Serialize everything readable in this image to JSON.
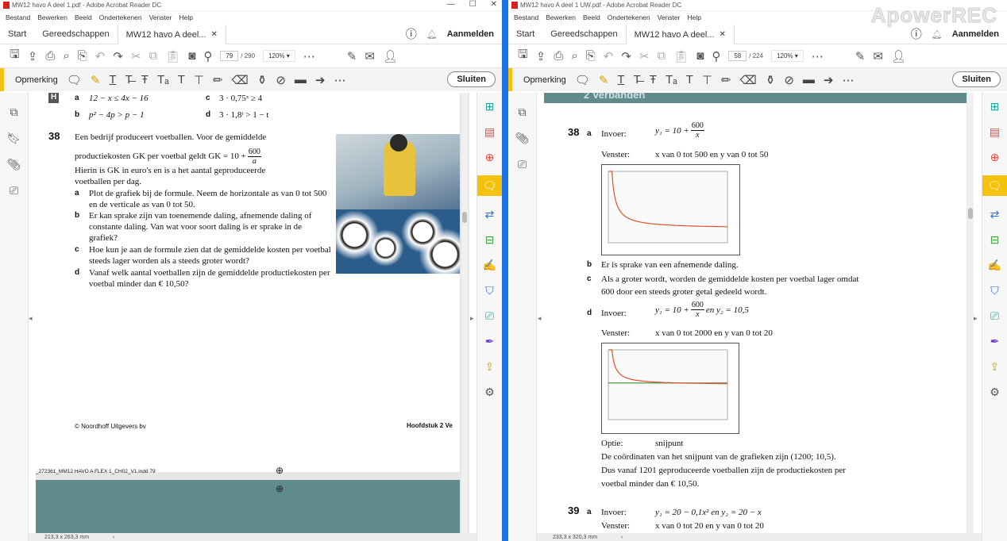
{
  "left": {
    "title": "MW12 havo A deel 1.pdf - Adobe Acrobat Reader DC",
    "menu": [
      "Bestand",
      "Bewerken",
      "Beeld",
      "Ondertekenen",
      "Venster",
      "Help"
    ],
    "tabs": {
      "start": "Start",
      "tools": "Gereedschappen",
      "doc": "MW12 havo A deel..."
    },
    "signin": "Aanmelden",
    "page_current": "79",
    "page_total": "/ 290",
    "zoom": "120%",
    "comment_label": "Opmerking",
    "close_label": "Sluiten",
    "page_size": "213,3 x 263,3 mm",
    "content": {
      "h_label": "H",
      "h_a_label": "a",
      "h_a": "12 − x ≤ 4x − 16",
      "h_c_label": "c",
      "h_c": "3 · 0,75ˣ ≥ 4",
      "h_b_label": "b",
      "h_b": "p² − 4p > p − 1",
      "h_d_label": "d",
      "h_d": "3 · 1,8ᵗ > 1 − t",
      "q38_num": "38",
      "q38_line1": "Een bedrijf produceert voetballen. Voor de gemiddelde",
      "q38_line2a": "productiekosten GK per voetbal geldt GK = 10 +",
      "q38_frac_n": "600",
      "q38_frac_d": "a",
      "q38_line3": "Hierin is GK in euro's en is a het aantal geproduceerde",
      "q38_line4": "voetballen per dag.",
      "q38_a_label": "a",
      "q38_a": "Plot de grafiek bij de formule. Neem de horizontale as van 0 tot 500 en de verticale as van 0 tot 50.",
      "q38_b_label": "b",
      "q38_b": "Er kan sprake zijn van toenemende daling, afnemende daling of constante daling. Van wat voor soort daling is er sprake in de grafiek?",
      "q38_c_label": "c",
      "q38_c": "Hoe kun je aan de formule zien dat de gemiddelde kosten per voetbal steeds lager worden als a steeds groter wordt?",
      "q38_d_label": "d",
      "q38_d": "Vanaf welk aantal voetballen zijn de gemiddelde productiekosten per voetbal minder dan € 10,50?",
      "footer_left": "© Noordhoff Uitgevers bv",
      "footer_right": "Hoofdstuk 2 Ve",
      "print_line": "_272361_MM12 HAVO A FLEX 1_CH02_V1.indd   79"
    }
  },
  "right": {
    "title": "MW12 havo A deel 1 UW.pdf - Adobe Acrobat Reader DC",
    "menu": [
      "Bestand",
      "Bewerken",
      "Beeld",
      "Ondertekenen",
      "Venster",
      "Help"
    ],
    "tabs": {
      "start": "Start",
      "tools": "Gereedschappen",
      "doc": "MW12 havo A deel..."
    },
    "signin": "Aanmelden",
    "page_current": "58",
    "page_total": "/ 224",
    "zoom": "120%",
    "comment_label": "Opmerking",
    "close_label": "Sluiten",
    "page_size": "233,3 x 320,3 mm",
    "watermark": "ApowerREC",
    "content": {
      "banner": "2 Verbanden",
      "q38_num": "38",
      "q38_a_label": "a",
      "invoer": "Invoer:",
      "venster": "Venster:",
      "y1_a": "y₁ = 10 +",
      "frac_n": "600",
      "frac_d": "x",
      "venster_a": "x van 0 tot 500 en y van 0 tot 50",
      "b_label": "b",
      "b_text": "Er is sprake van een afnemende daling.",
      "c_label": "c",
      "c_text1": "Als a groter wordt, worden de gemiddelde kosten per voetbal lager omdat",
      "c_text2": "600 door een steeds groter getal gedeeld wordt.",
      "d_label": "d",
      "y1_d": "y₁ = 10 +",
      "y2_d": "en y₂ = 10,5",
      "venster_d": "x van 0 tot 2000 en y van 0 tot 20",
      "optie": "Optie:",
      "optie_val": "snijpunt",
      "coord_text": "De coördinaten van het snijpunt van de grafieken zijn (1200; 10,5).",
      "concl1": "Dus vanaf 1201 geproduceerde voetballen zijn de productiekosten per",
      "concl2": "voetbal minder dan € 10,50.",
      "q39_num": "39",
      "q39_a_label": "a",
      "q39_invoer": "y₁ = 20 − 0,1x² en y₂ = 20 − x",
      "q39_venster": "x van 0 tot 20 en y van 0 tot 20"
    }
  }
}
